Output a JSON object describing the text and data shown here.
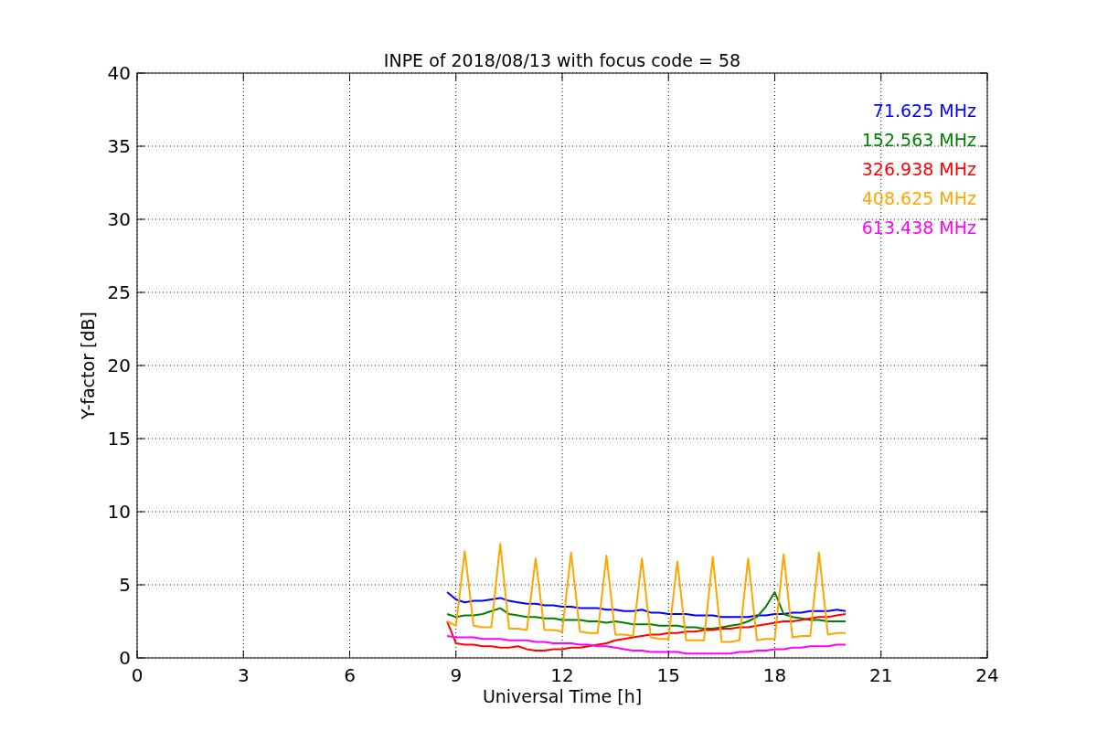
{
  "chart_data": {
    "type": "line",
    "grid": true,
    "title": "INPE of 2018/08/13 with focus code = 58",
    "xlabel": "Universal Time [h]",
    "ylabel": "Y-factor [dB]",
    "xlim": [
      0,
      24
    ],
    "ylim": [
      0,
      40
    ],
    "xticks": [
      0,
      3,
      6,
      9,
      12,
      15,
      18,
      21,
      24
    ],
    "yticks": [
      0,
      5,
      10,
      15,
      20,
      25,
      30,
      35,
      40
    ],
    "x": [
      8.75,
      9,
      9.25,
      9.5,
      9.75,
      10,
      10.25,
      10.5,
      10.75,
      11,
      11.25,
      11.5,
      11.75,
      12,
      12.25,
      12.5,
      12.75,
      13,
      13.25,
      13.5,
      13.75,
      14,
      14.25,
      14.5,
      14.75,
      15,
      15.25,
      15.5,
      15.75,
      16,
      16.25,
      16.5,
      16.75,
      17,
      17.25,
      17.5,
      17.75,
      18,
      18.25,
      18.5,
      18.75,
      19,
      19.25,
      19.5,
      19.75,
      20
    ],
    "series": [
      {
        "name": "71.625 MHz",
        "color": "#0000ff",
        "values": [
          4.5,
          4.0,
          3.8,
          3.9,
          3.9,
          4.0,
          4.1,
          3.9,
          3.8,
          3.7,
          3.7,
          3.6,
          3.6,
          3.5,
          3.5,
          3.4,
          3.4,
          3.4,
          3.3,
          3.3,
          3.2,
          3.2,
          3.3,
          3.1,
          3.1,
          3.0,
          3.0,
          3.0,
          2.9,
          2.9,
          2.9,
          2.8,
          2.8,
          2.8,
          2.8,
          2.9,
          2.9,
          3.0,
          3.0,
          3.1,
          3.1,
          3.2,
          3.2,
          3.2,
          3.3,
          3.2
        ]
      },
      {
        "name": "152.563 MHz",
        "color": "#008000",
        "values": [
          3.0,
          2.8,
          2.9,
          2.9,
          3.0,
          3.2,
          3.4,
          3.0,
          2.9,
          2.8,
          2.8,
          2.7,
          2.7,
          2.6,
          2.6,
          2.6,
          2.5,
          2.5,
          2.4,
          2.5,
          2.4,
          2.3,
          2.3,
          2.3,
          2.2,
          2.2,
          2.2,
          2.1,
          2.1,
          2.0,
          2.0,
          2.1,
          2.2,
          2.3,
          2.5,
          2.8,
          3.5,
          4.5,
          3.0,
          2.8,
          2.7,
          2.6,
          2.6,
          2.5,
          2.5,
          2.5
        ]
      },
      {
        "name": "326.938 MHz",
        "color": "#ff0000",
        "values": [
          2.5,
          1.0,
          0.9,
          0.9,
          0.8,
          0.8,
          0.7,
          0.7,
          0.8,
          0.6,
          0.5,
          0.5,
          0.6,
          0.6,
          0.7,
          0.7,
          0.8,
          0.9,
          1.0,
          1.2,
          1.3,
          1.4,
          1.5,
          1.6,
          1.6,
          1.7,
          1.7,
          1.8,
          1.8,
          1.9,
          1.9,
          2.0,
          2.0,
          2.1,
          2.1,
          2.2,
          2.3,
          2.4,
          2.5,
          2.5,
          2.6,
          2.7,
          2.8,
          2.8,
          2.9,
          3.0
        ]
      },
      {
        "name": "408.625 MHz",
        "color": "#ffa500",
        "values": [
          2.5,
          2.2,
          7.3,
          2.2,
          2.1,
          2.1,
          7.8,
          2.0,
          2.0,
          1.9,
          6.8,
          1.9,
          1.9,
          1.8,
          7.2,
          1.8,
          1.7,
          1.7,
          7.0,
          1.6,
          1.6,
          1.5,
          6.8,
          1.4,
          1.3,
          1.3,
          6.6,
          1.2,
          1.2,
          1.2,
          6.9,
          1.1,
          1.1,
          1.2,
          6.8,
          1.2,
          1.3,
          1.3,
          7.1,
          1.4,
          1.5,
          1.5,
          7.2,
          1.6,
          1.7,
          1.7
        ]
      },
      {
        "name": "613.438 MHz",
        "color": "#ff00ff",
        "values": [
          1.5,
          1.4,
          1.4,
          1.4,
          1.3,
          1.3,
          1.3,
          1.2,
          1.2,
          1.2,
          1.1,
          1.1,
          1.0,
          1.0,
          1.0,
          0.9,
          0.9,
          0.8,
          0.8,
          0.7,
          0.6,
          0.5,
          0.5,
          0.4,
          0.4,
          0.4,
          0.4,
          0.3,
          0.3,
          0.3,
          0.3,
          0.3,
          0.3,
          0.4,
          0.4,
          0.5,
          0.5,
          0.6,
          0.6,
          0.7,
          0.7,
          0.8,
          0.8,
          0.8,
          0.9,
          0.9
        ]
      }
    ]
  }
}
